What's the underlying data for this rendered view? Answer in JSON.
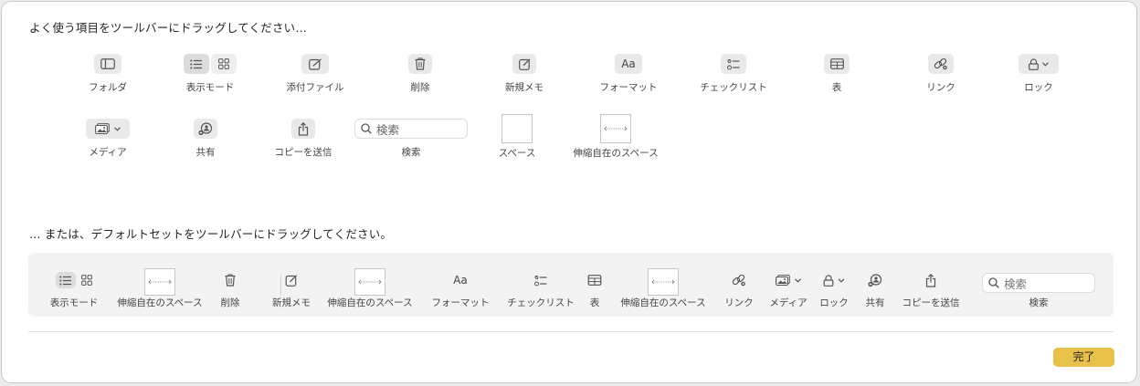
{
  "sheet": {
    "top_heading": "よく使う項目をツールバーにドラッグしてください…",
    "bottom_heading": "… または、デフォルトセットをツールバーにドラッグしてください。",
    "done_label": "完了"
  },
  "palette": {
    "folders": "フォルダ",
    "view_mode": "表示モード",
    "attachments": "添付ファイル",
    "delete": "削除",
    "new_note": "新規メモ",
    "format": "フォーマット",
    "checklist": "チェックリスト",
    "table": "表",
    "link": "リンク",
    "lock": "ロック",
    "media": "メディア",
    "share": "共有",
    "send_copy": "コピーを送信",
    "search": "検索",
    "search_placeholder": "検索",
    "space": "スペース",
    "flex_space": "伸縮自在のスペース",
    "format_glyph": "Aa"
  },
  "default_set": {
    "view_mode": "表示モード",
    "flex_space_1": "伸縮自在のスペース",
    "delete": "削除",
    "new_note": "新規メモ",
    "flex_space_2": "伸縮自在のスペース",
    "format": "フォーマット",
    "checklist": "チェックリスト",
    "table": "表",
    "flex_space_3": "伸縮自在のスペース",
    "link": "リンク",
    "media": "メディア",
    "lock": "ロック",
    "share": "共有",
    "send_copy": "コピーを送信",
    "search": "検索",
    "search_placeholder": "検索",
    "format_glyph": "Aa"
  },
  "colors": {
    "accent": "#e7c14a",
    "sheet_bg": "#ffffff",
    "bar_bg": "#f3f3f3"
  }
}
